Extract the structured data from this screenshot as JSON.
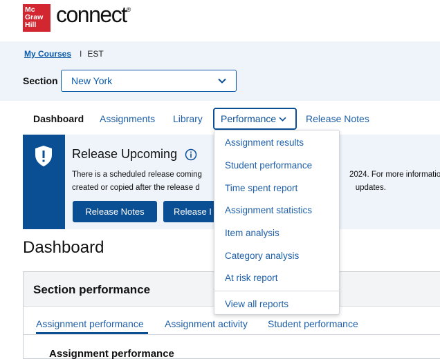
{
  "brand": {
    "logo_lines": [
      "Mc",
      "Graw",
      "Hill"
    ],
    "name": "connect",
    "trademark": "®"
  },
  "breadcrumb": {
    "link": "My Courses",
    "separator": "I",
    "course": "EST"
  },
  "section": {
    "label": "Section",
    "selected": "New York"
  },
  "nav": {
    "items": [
      "Dashboard",
      "Assignments",
      "Library",
      "Performance",
      "Release Notes"
    ],
    "active": "Dashboard",
    "open": "Performance"
  },
  "performance_menu": {
    "items": [
      "Assignment results",
      "Student performance",
      "Time spent report",
      "Assignment statistics",
      "Item analysis",
      "Category analysis",
      "At risk report"
    ],
    "footer_item": "View all reports"
  },
  "banner": {
    "title": "Release Upcoming",
    "line1_a": "There is a scheduled release coming",
    "line1_b": "2024. For more informatio",
    "line2_a": "created or copied after the release d",
    "line2_b": "updates.",
    "buttons": [
      "Release Notes",
      "Release I"
    ]
  },
  "dashboard": {
    "title": "Dashboard",
    "card_title": "Section performance",
    "tabs": [
      "Assignment performance",
      "Assignment activity",
      "Student performance"
    ],
    "active_tab": "Assignment performance",
    "section_heading": "Assignment performance"
  },
  "colors": {
    "brand_red": "#d22630",
    "primary_blue": "#0a4e94",
    "link_blue": "#1e5fa8",
    "band_bg": "#eef4fa"
  }
}
